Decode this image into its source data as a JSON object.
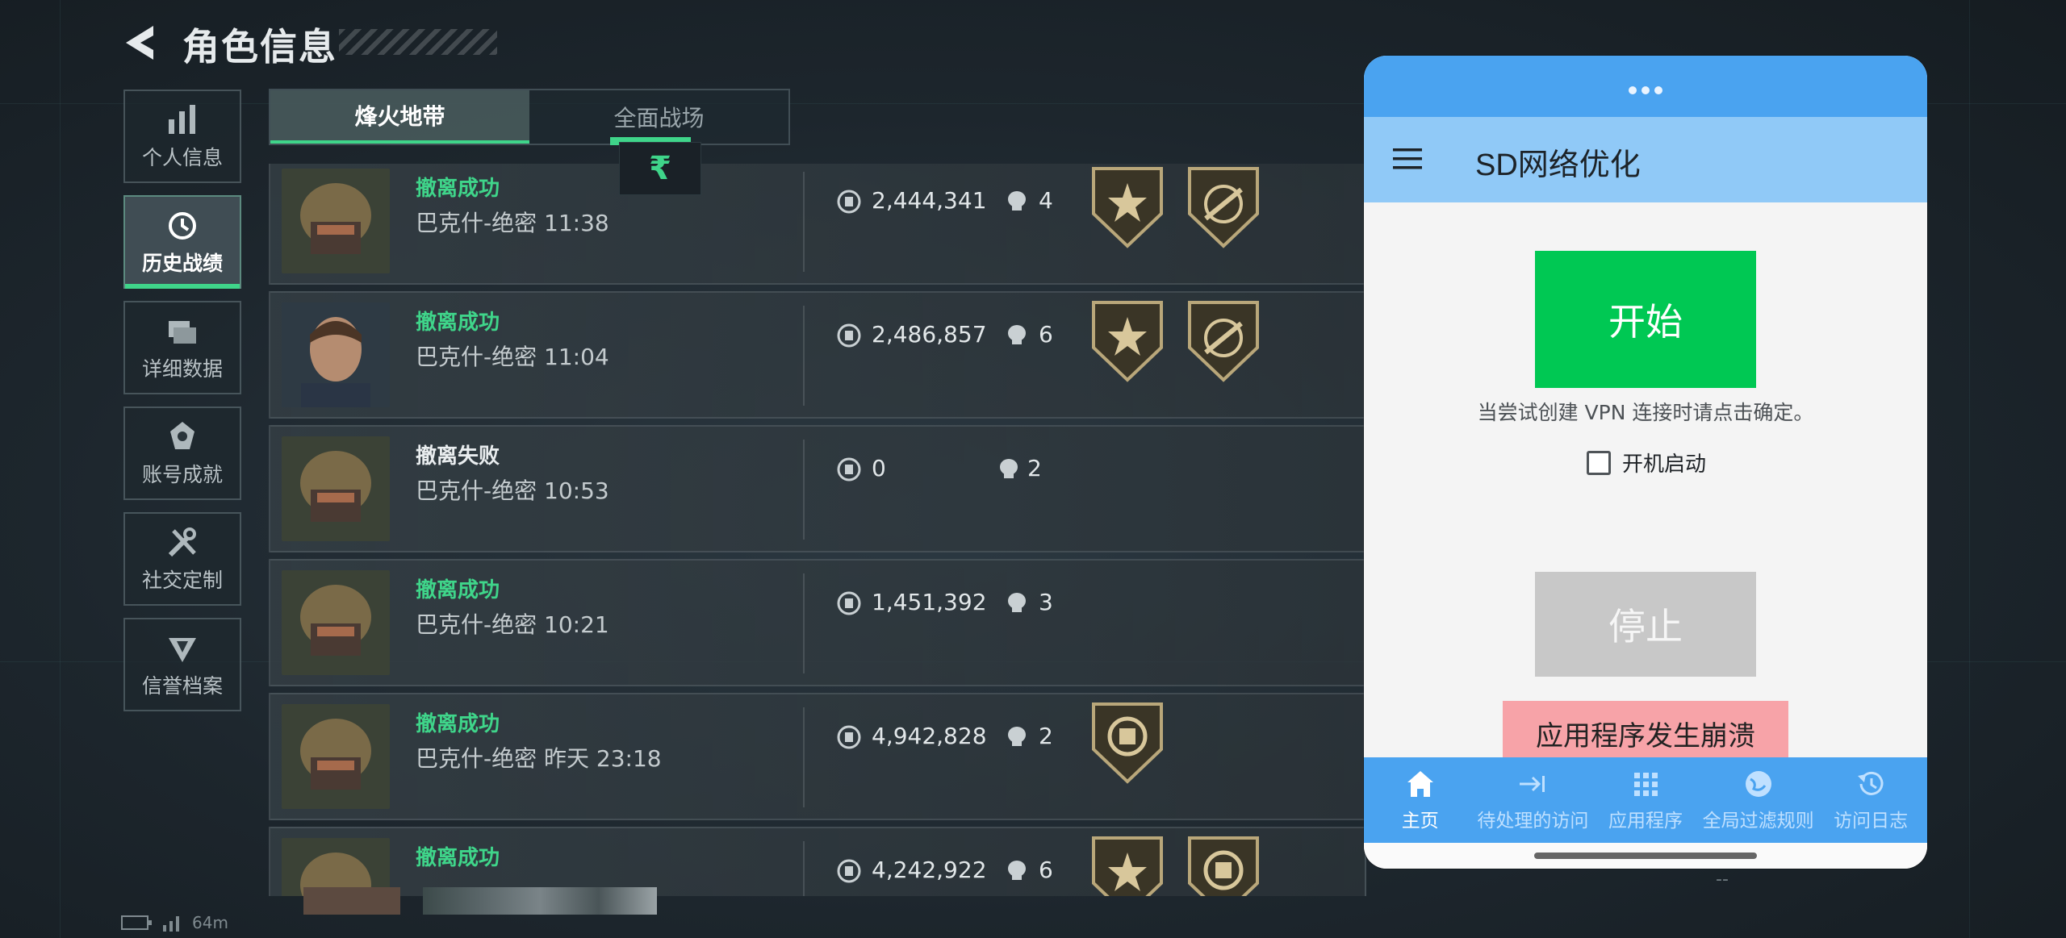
{
  "header": {
    "title": "角色信息"
  },
  "sidebar": {
    "items": [
      {
        "label": "个人信息",
        "icon": "bar-chart-icon"
      },
      {
        "label": "历史战绩",
        "icon": "clock-history-icon",
        "active": true
      },
      {
        "label": "详细数据",
        "icon": "folder-icon"
      },
      {
        "label": "账号成就",
        "icon": "achievement-icon"
      },
      {
        "label": "社交定制",
        "icon": "tools-icon"
      },
      {
        "label": "信誉档案",
        "icon": "shield-icon"
      }
    ]
  },
  "mode_tabs": [
    {
      "label": "烽火地带",
      "active": true
    },
    {
      "label": "全面战场",
      "active": false
    }
  ],
  "badge": "₹",
  "records": [
    {
      "status": "撤离成功",
      "map_time": "巴克什-绝密 11:38",
      "coins": "2,444,341",
      "kills": "4",
      "medals": [
        "star-medal",
        "weapon-medal"
      ]
    },
    {
      "status": "撤离成功",
      "map_time": "巴克什-绝密 11:04",
      "coins": "2,486,857",
      "kills": "6",
      "medals": [
        "star-medal",
        "weapon-medal"
      ]
    },
    {
      "status": "撤离失败",
      "map_time": "巴克什-绝密 10:53",
      "coins": "0",
      "kills": "2",
      "medals": []
    },
    {
      "status": "撤离成功",
      "map_time": "巴克什-绝密 10:21",
      "coins": "1,451,392",
      "kills": "3",
      "medals": []
    },
    {
      "status": "撤离成功",
      "map_time": "巴克什-绝密 昨天 23:18",
      "coins": "4,942,828",
      "kills": "2",
      "medals": [
        "coin-medal"
      ]
    },
    {
      "status": "撤离成功",
      "map_time": "",
      "coins": "4,242,922",
      "kills": "6",
      "medals": [
        "star-medal",
        "coin-medal"
      ]
    }
  ],
  "status_bar": {
    "signal_text": "64m"
  },
  "phone_app": {
    "title": "SD网络优化",
    "start_label": "开始",
    "hint": "当尝试创建 VPN 连接时请点击确定。",
    "autostart_label": "开机启动",
    "autostart_checked": false,
    "stop_label": "停止",
    "crash_text": "应用程序发生崩溃",
    "nav": [
      {
        "label": "主页",
        "icon": "home-icon",
        "active": true
      },
      {
        "label": "待处理的访问",
        "icon": "arrow-to-bar-icon"
      },
      {
        "label": "应用程序",
        "icon": "apps-grid-icon"
      },
      {
        "label": "全局过滤规则",
        "icon": "globe-icon"
      },
      {
        "label": "访问日志",
        "icon": "history-icon"
      }
    ]
  },
  "footer_mark": "--",
  "colors": {
    "accent_green": "#3fd58a",
    "start_green": "#00c853",
    "phone_blue": "#4aa3f0",
    "appbar_blue": "#90c9f7",
    "crash_pink": "#f7a3a8"
  }
}
